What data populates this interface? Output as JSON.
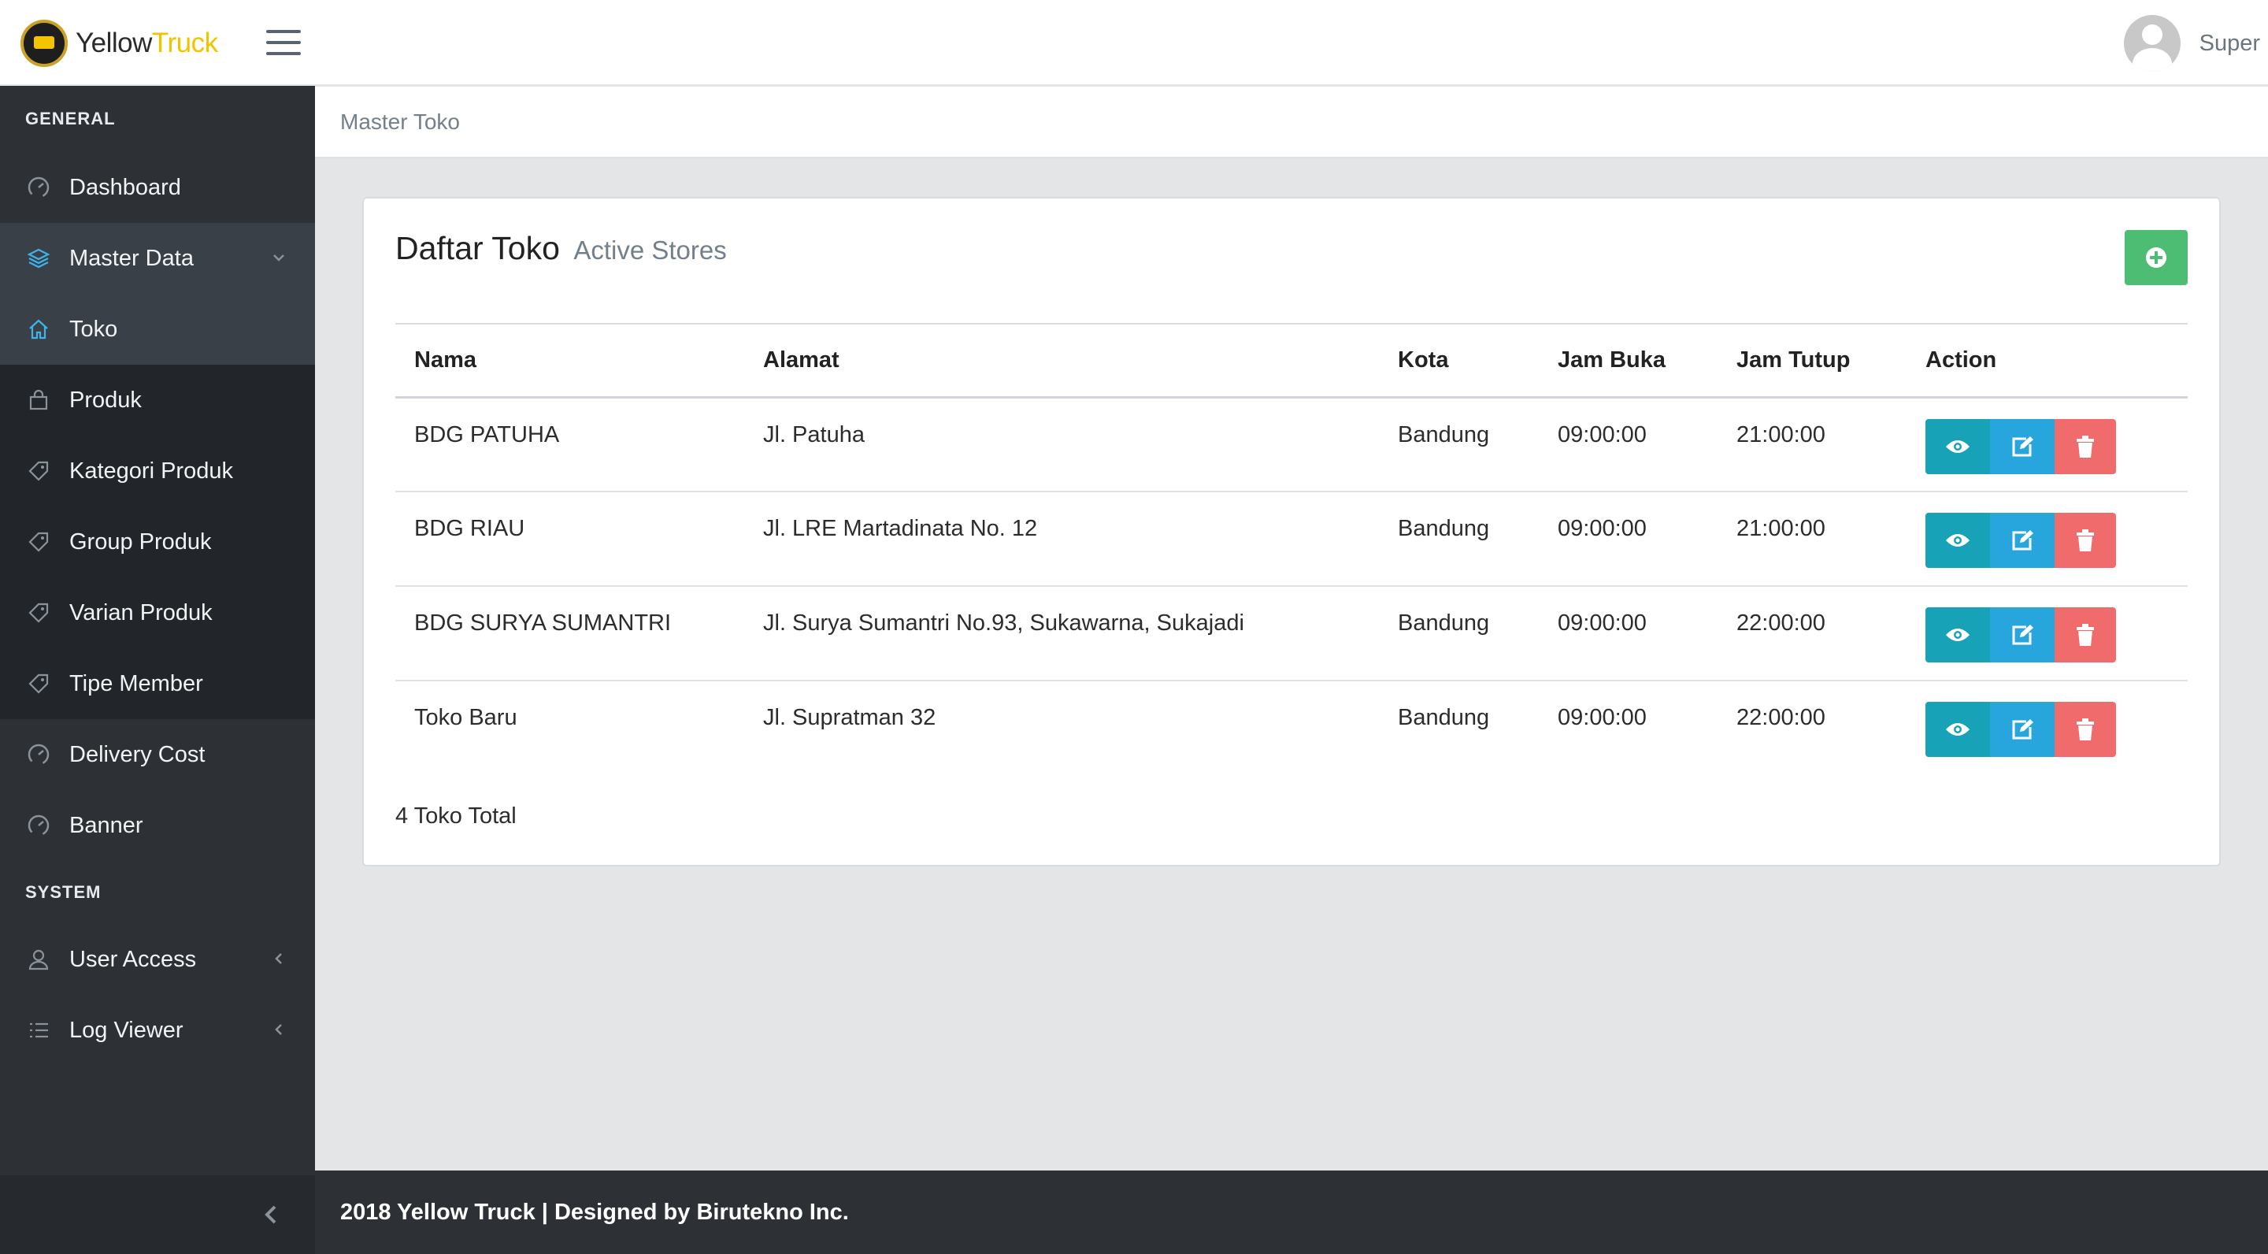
{
  "brand": {
    "name_part1": "Yellow",
    "name_part2": "Truck"
  },
  "user": {
    "name": "Super"
  },
  "sidebar": {
    "general_label": "GENERAL",
    "system_label": "SYSTEM",
    "items": [
      {
        "label": "Dashboard",
        "icon": "gauge-icon"
      },
      {
        "label": "Master Data",
        "icon": "layers-icon"
      },
      {
        "label": "Toko",
        "icon": "home-icon"
      },
      {
        "label": "Produk",
        "icon": "bag-icon"
      },
      {
        "label": "Kategori Produk",
        "icon": "tag-icon"
      },
      {
        "label": "Group Produk",
        "icon": "tag-icon"
      },
      {
        "label": "Varian Produk",
        "icon": "tag-icon"
      },
      {
        "label": "Tipe Member",
        "icon": "tag-icon"
      },
      {
        "label": "Delivery Cost",
        "icon": "gauge-icon"
      },
      {
        "label": "Banner",
        "icon": "gauge-icon"
      },
      {
        "label": "User Access",
        "icon": "user-icon"
      },
      {
        "label": "Log Viewer",
        "icon": "list-icon"
      }
    ]
  },
  "breadcrumb": {
    "current": "Master Toko"
  },
  "card": {
    "title": "Daftar Toko",
    "subtitle": "Active Stores",
    "total": "4 Toko Total"
  },
  "table": {
    "headers": [
      "Nama",
      "Alamat",
      "Kota",
      "Jam Buka",
      "Jam Tutup",
      "Action"
    ],
    "rows": [
      [
        "BDG PATUHA",
        "Jl. Patuha",
        "Bandung",
        "09:00:00",
        "21:00:00"
      ],
      [
        "BDG RIAU",
        "Jl. LRE Martadinata No. 12",
        "Bandung",
        "09:00:00",
        "21:00:00"
      ],
      [
        "BDG SURYA SUMANTRI",
        "Jl. Surya Sumantri No.93, Sukawarna, Sukajadi",
        "Bandung",
        "09:00:00",
        "22:00:00"
      ],
      [
        "Toko Baru",
        "Jl. Supratman 32",
        "Bandung",
        "09:00:00",
        "22:00:00"
      ]
    ]
  },
  "footer": {
    "text": "2018 Yellow Truck | Designed by Birutekno Inc."
  },
  "colors": {
    "sidebar": "#2d3135",
    "success": "#4dbd74",
    "info": "#17a2b8",
    "primary": "#26a6dc",
    "danger": "#f06c6c",
    "brand_yellow": "#f0c400"
  }
}
